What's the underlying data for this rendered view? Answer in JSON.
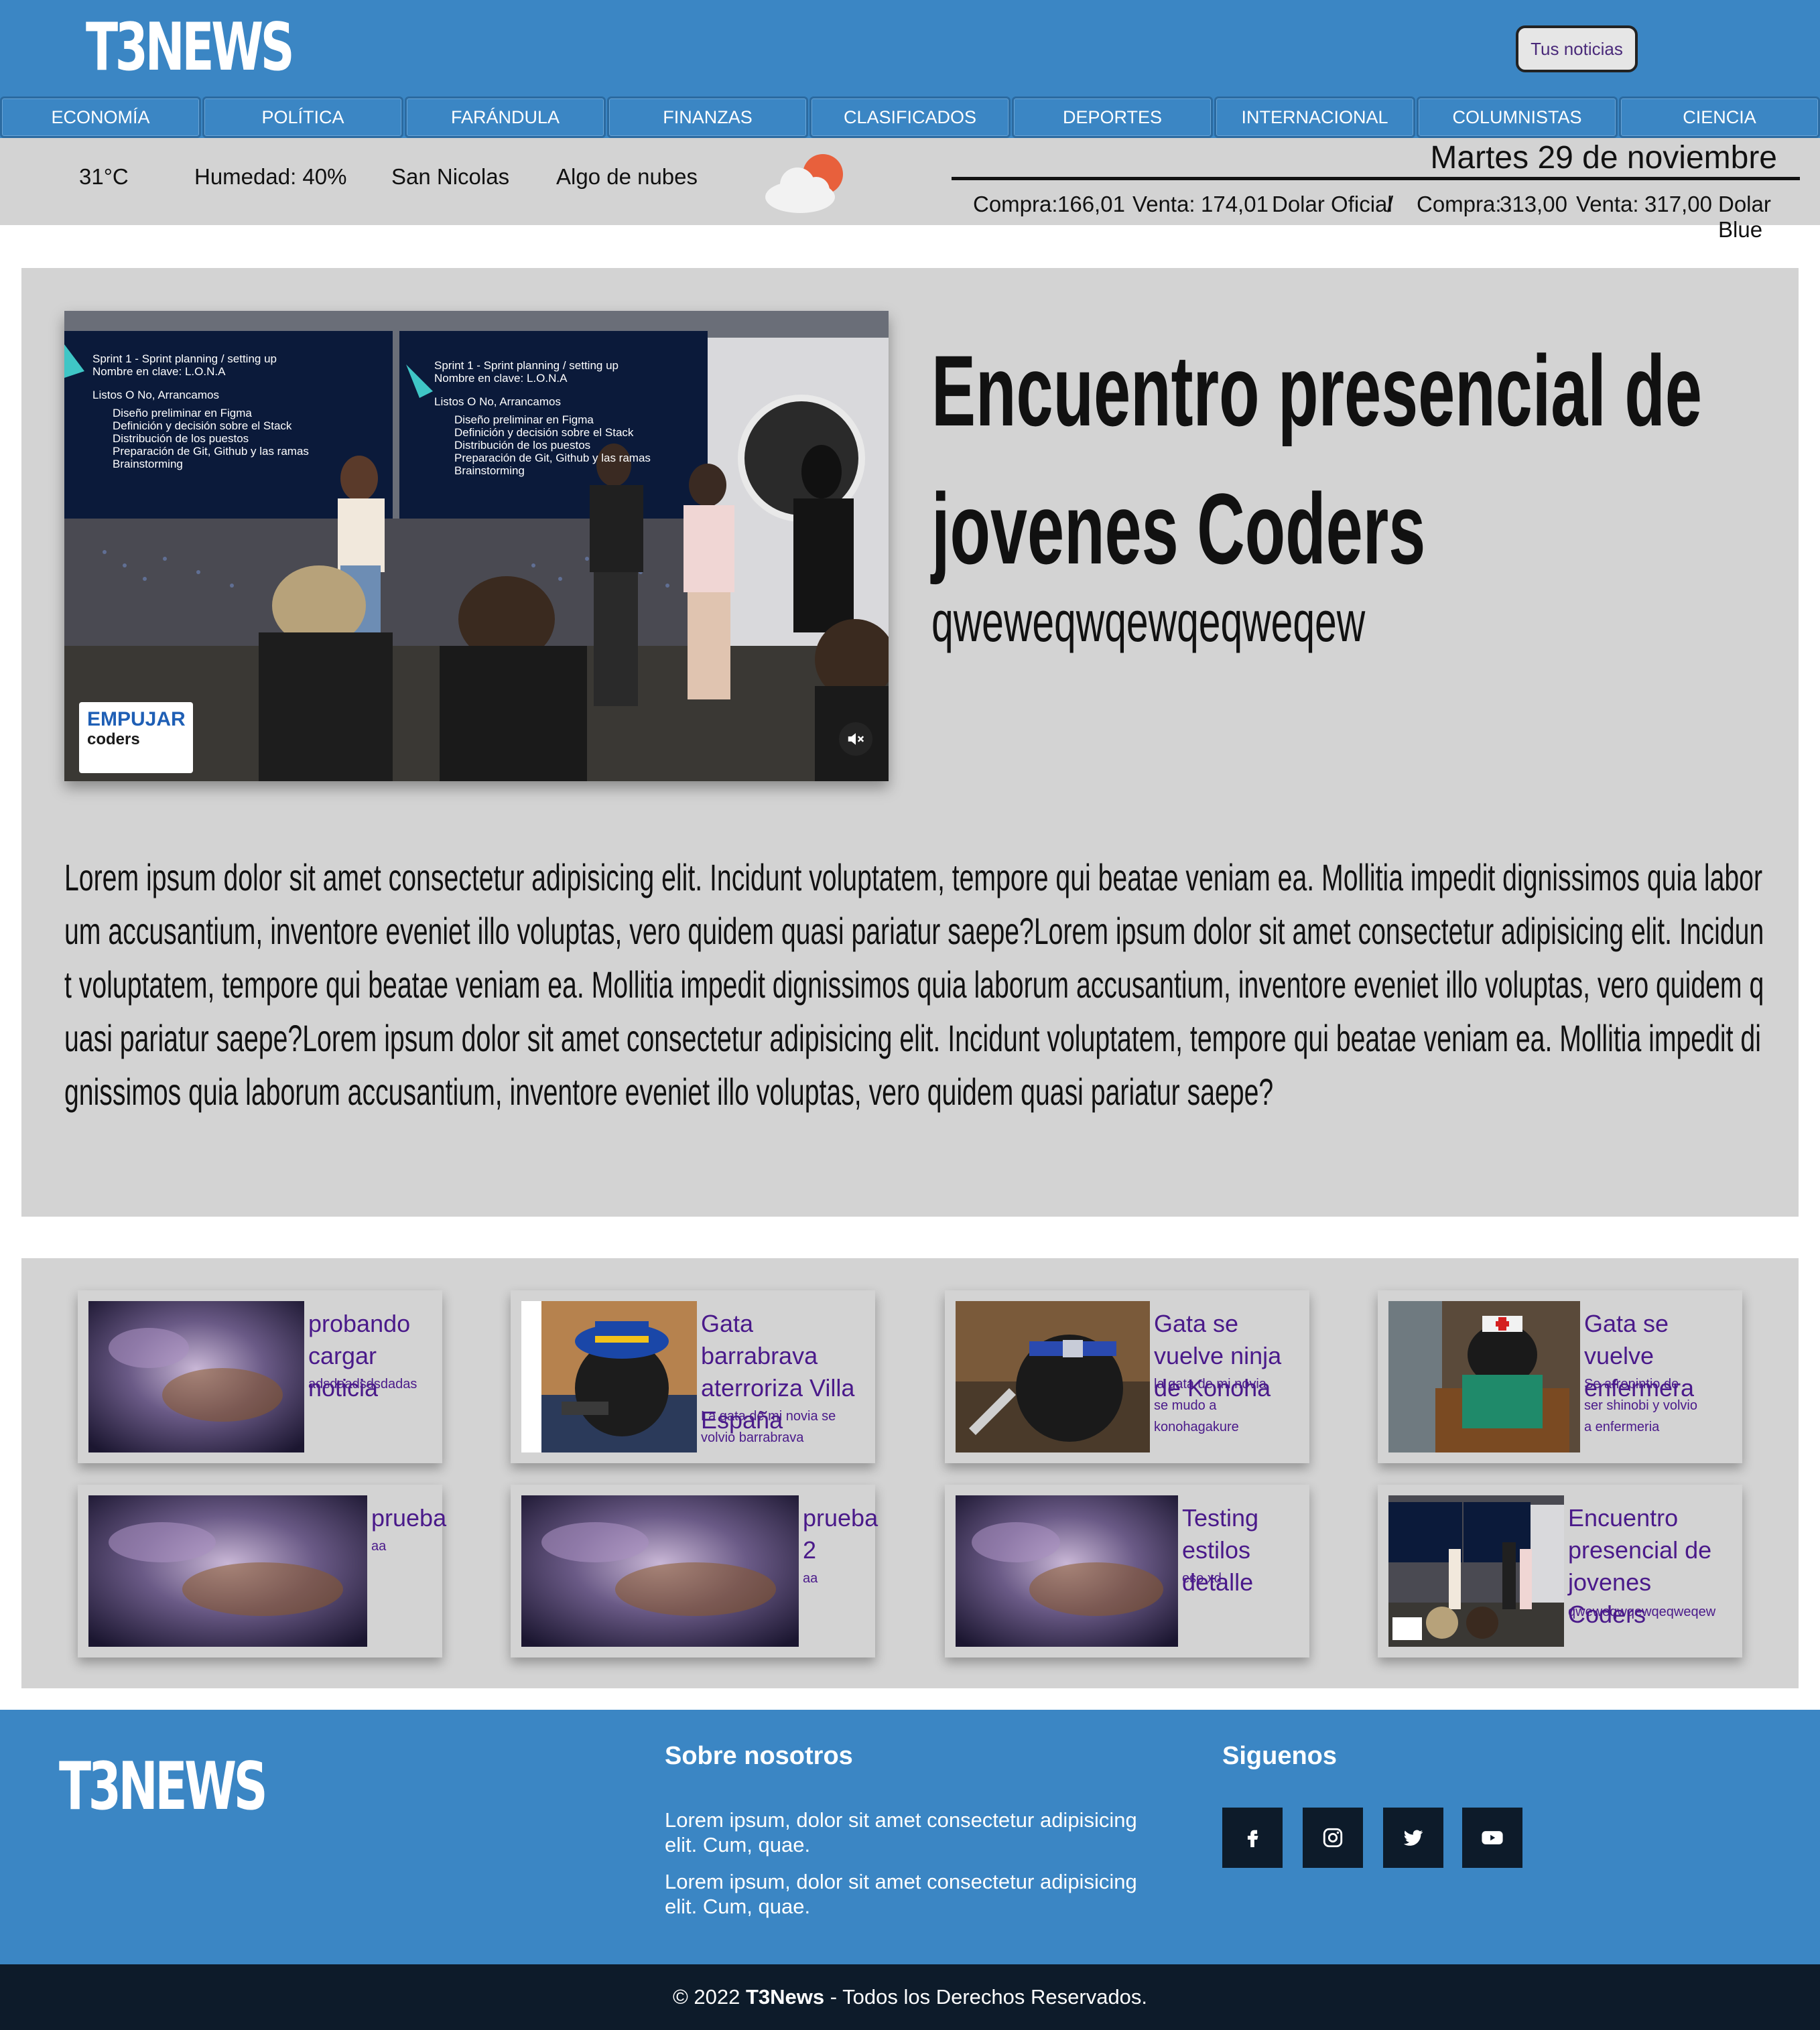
{
  "header": {
    "logo": "T3NEWS",
    "user_button": "Tus noticias"
  },
  "nav": [
    "ECONOMÍA",
    "POLÍTICA",
    "FARÁNDULA",
    "FINANZAS",
    "CLASIFICADOS",
    "DEPORTES",
    "INTERNACIONAL",
    "COLUMNISTAS",
    "CIENCIA"
  ],
  "weather": {
    "temp": "31°C",
    "humidity": "Humedad: 40%",
    "city": "San Nicolas",
    "condition": "Algo de nubes",
    "icon": "partly-cloudy-icon"
  },
  "date": "Martes 29 de noviembre",
  "dolar": {
    "official": {
      "compra_label": "Compra:",
      "compra": "166,01",
      "venta_label": "Venta:",
      "venta": "174,01",
      "name": "Dolar Oficial"
    },
    "separator": "/",
    "blue": {
      "compra_label": "Compra:",
      "compra": "313,00",
      "venta_label": "Venta:",
      "venta": "317,00",
      "name": "Dolar Blue"
    }
  },
  "featured": {
    "title": "Encuentro presencial de jovenes Coders",
    "subtitle": "qweweqwqewqeqweqew",
    "body": "Lorem ipsum dolor sit amet consectetur adipisicing elit. Incidunt voluptatem, tempore qui beatae veniam ea. Mollitia impedit dignissimos quia laborum accusantium, inventore eveniet illo voluptas, vero quidem quasi pariatur saepe?Lorem ipsum dolor sit amet consectetur adipisicing elit. Incidunt voluptatem, tempore qui beatae veniam ea. Mollitia impedit dignissimos quia laborum accusantium, inventore eveniet illo voluptas, vero quidem quasi pariatur saepe?Lorem ipsum dolor sit amet consectetur adipisicing elit. Incidunt voluptatem, tempore qui beatae veniam ea. Mollitia impedit dignissimos quia laborum accusantium, inventore eveniet illo voluptas, vero quidem quasi pariatur saepe?",
    "video": {
      "slide_title": "Sprint 1 - Sprint planning / setting up",
      "slide_sub": "Nombre en clave: L.O.N.A",
      "slide_list_title": "Listos O No, Arrancamos",
      "slide_items": [
        "Diseño preliminar en Figma",
        "Definición y decisión sobre el Stack",
        "Distribución de los puestos",
        "Preparación de Git, Github y las ramas",
        "Brainstorming"
      ],
      "badge_line1": "EMPUJAR",
      "badge_line2": "coders",
      "mute_icon": "muted-speaker-icon"
    }
  },
  "news": [
    {
      "title": "probando cargar noticia",
      "desc": "adsdaadsdsdadas",
      "image": "nebula"
    },
    {
      "title": "Gata barrabrava aterroriza Villa España",
      "desc": "La gata de mi novia se volvio barrabrava",
      "image": "cat-hat"
    },
    {
      "title": "Gata se vuelve ninja de Konoha",
      "desc": "la gata de mi novia se mudo a konohagakure",
      "image": "cat-ninja"
    },
    {
      "title": "Gata se vuelve enfermera",
      "desc": "Se arrepintio de ser shinobi y volvio a enfermeria",
      "image": "cat-nurse"
    },
    {
      "title": "prueba",
      "desc": "aa",
      "image": "nebula"
    },
    {
      "title": "prueba 2",
      "desc": "aa",
      "image": "nebula"
    },
    {
      "title": "Testing estilos detalle",
      "desc": "eso xd",
      "image": "nebula"
    },
    {
      "title": "Encuentro presencial de jovenes Coders",
      "desc": "qweweqwqewqeqweqew",
      "image": "event"
    }
  ],
  "footer": {
    "logo": "T3NEWS",
    "about_title": "Sobre nosotros",
    "about_p1": "Lorem ipsum, dolor sit amet consectetur adipisicing elit. Cum, quae.",
    "about_p2": "Lorem ipsum, dolor sit amet consectetur adipisicing elit. Cum, quae.",
    "follow_title": "Siguenos",
    "social": [
      "facebook-icon",
      "instagram-icon",
      "twitter-icon",
      "youtube-icon"
    ],
    "copyright_pre": "© 2022 ",
    "copyright_brand": "T3News",
    "copyright_post": " - Todos los Derechos Reservados."
  },
  "colors": {
    "brand_blue": "#3b86c4",
    "panel_gray": "#d3d3d3",
    "dark_navy": "#0d1b2a",
    "news_link": "#4a1a8a"
  }
}
